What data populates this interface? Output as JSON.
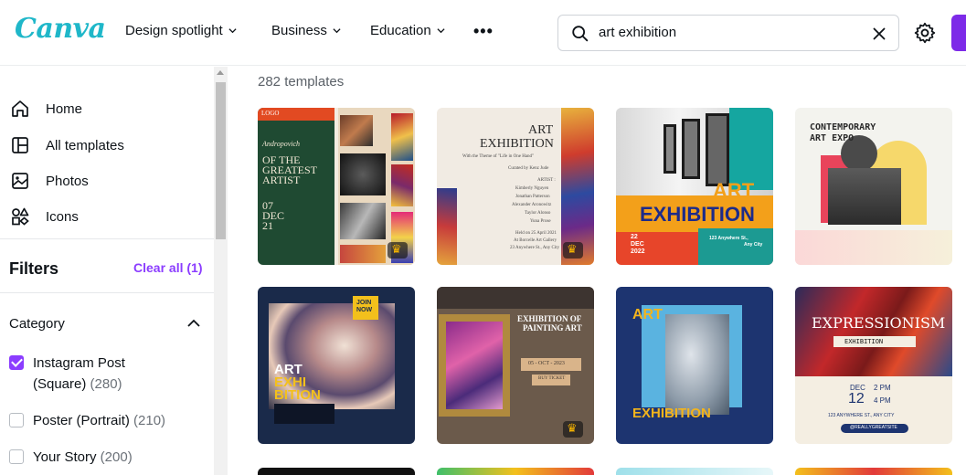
{
  "header": {
    "logo": "Canva",
    "nav": [
      "Design spotlight",
      "Business",
      "Education"
    ],
    "more_label": "•••",
    "search_value": "art exhibition",
    "accent": "#7d2ae8"
  },
  "sidebar": {
    "items": [
      {
        "label": "Home",
        "icon": "home-icon"
      },
      {
        "label": "All templates",
        "icon": "templates-icon"
      },
      {
        "label": "Photos",
        "icon": "photos-icon"
      },
      {
        "label": "Icons",
        "icon": "shapes-icon"
      }
    ],
    "filters_title": "Filters",
    "clear_all": "Clear all (1)",
    "category_title": "Category",
    "categories": [
      {
        "label": "Instagram Post",
        "label2": "(Square)",
        "count": "(280)",
        "checked": true
      },
      {
        "label": "Poster (Portrait)",
        "count": "(210)",
        "checked": false
      },
      {
        "label": "Your Story",
        "count": "(200)",
        "checked": false
      }
    ]
  },
  "main": {
    "template_count": "282 templates",
    "cards": [
      {
        "name": "Art exhibition green",
        "lines": [
          "LOGO",
          "Andropovich",
          "OF THE",
          "GREATEST",
          "ARTIST",
          "07",
          "DEC",
          "21"
        ]
      },
      {
        "name": "Art exhibition beige",
        "lines": [
          "ART",
          "EXHIBITION",
          "With the Theme of \"Life in One Hand\"",
          "Curated by Kenz Jude",
          "ARTIST :",
          "Kimberly Nguyen",
          "Jonathan Patterson",
          "Alexander Aronowitz",
          "Taylor Alonso",
          "Yuna Prose",
          "Held on 25 April 2021",
          "At Borcelle Art Gallery",
          "23 Anywhere St., Any City"
        ]
      },
      {
        "name": "Art exhibition orange",
        "lines": [
          "ART",
          "EXHIBITION",
          "22",
          "DEC",
          "2022",
          "123 Anywhere St.,",
          "Any City"
        ]
      },
      {
        "name": "Contemporary art expo",
        "lines": [
          "CONTEMPORARY",
          "ART EXPO"
        ]
      },
      {
        "name": "Art exhibition marble",
        "lines": [
          "JOIN",
          "NOW",
          "ART",
          "EXHI",
          "BITION"
        ]
      },
      {
        "name": "Exhibition of painting art",
        "lines": [
          "EXHIBITION OF",
          "PAINTING ART",
          "05 - OCT - 2023",
          "BUY TICKET"
        ]
      },
      {
        "name": "Art exhibition statue",
        "lines": [
          "ART",
          "EXHIBITION"
        ]
      },
      {
        "name": "Expressionism exhibition",
        "lines": [
          "EXPRESSIONISM",
          "EXHIBITION",
          "DEC",
          "12",
          "2 PM",
          "4 PM",
          "123 ANYWHERE ST., ANY CITY",
          "@REALLYGREATSITE"
        ]
      }
    ]
  }
}
